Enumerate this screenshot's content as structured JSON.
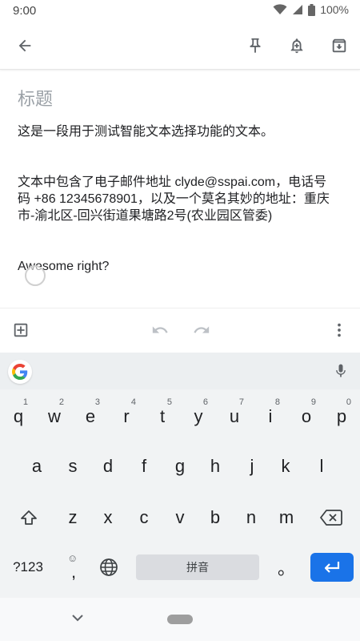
{
  "status": {
    "time": "9:00",
    "battery": "100%"
  },
  "note": {
    "title_placeholder": "标题",
    "body": "这是一段用于测试智能文本选择功能的文本。\n\n\n文本中包含了电子邮件地址 clyde@sspai.com，电话号码 +86 12345678901，以及一个莫名其妙的地址：重庆市-渝北区-回兴街道果塘路2号(农业园区管委)\n\n\nAwesome right?"
  },
  "keyboard": {
    "row1": [
      {
        "key": "q",
        "hint": "1"
      },
      {
        "key": "w",
        "hint": "2"
      },
      {
        "key": "e",
        "hint": "3"
      },
      {
        "key": "r",
        "hint": "4"
      },
      {
        "key": "t",
        "hint": "5"
      },
      {
        "key": "y",
        "hint": "6"
      },
      {
        "key": "u",
        "hint": "7"
      },
      {
        "key": "i",
        "hint": "8"
      },
      {
        "key": "o",
        "hint": "9"
      },
      {
        "key": "p",
        "hint": "0"
      }
    ],
    "row2": [
      "a",
      "s",
      "d",
      "f",
      "g",
      "h",
      "j",
      "k",
      "l"
    ],
    "row3": [
      "z",
      "x",
      "c",
      "v",
      "b",
      "n",
      "m"
    ],
    "symbols_label": "?123",
    "comma_label": ",",
    "space_label": "拼音",
    "period_label": "。"
  }
}
